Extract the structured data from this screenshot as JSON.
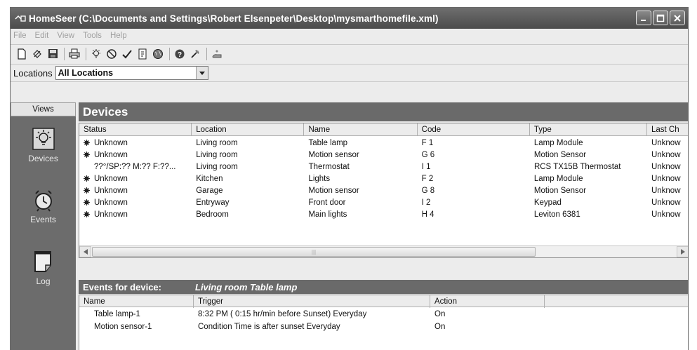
{
  "window": {
    "title": "HomeSeer (C:\\Documents and Settings\\Robert Elsenpeter\\Desktop\\mysmarthomefile.xml)",
    "buttons": [
      "minimize",
      "maximize",
      "close"
    ]
  },
  "menu": [
    "File",
    "Edit",
    "View",
    "Tools",
    "Help"
  ],
  "toolbar": {
    "icons": [
      "new-file-icon",
      "open-icon",
      "save-icon",
      "print-icon",
      "light-icon",
      "clock-icon",
      "check-icon",
      "document-icon",
      "globe-icon",
      "help-icon",
      "tool-icon",
      "hand-icon"
    ]
  },
  "locations": {
    "label": "Locations",
    "selected": "All Locations"
  },
  "views": {
    "header": "Views",
    "items": [
      {
        "label": "Devices",
        "icon": "lightbulb-icon"
      },
      {
        "label": "Events",
        "icon": "alarm-clock-icon"
      },
      {
        "label": "Log",
        "icon": "notepad-icon"
      }
    ]
  },
  "devices": {
    "title": "Devices",
    "columns": [
      "Status",
      "Location",
      "Name",
      "Code",
      "Type",
      "Last Ch"
    ],
    "rows": [
      {
        "status": "Unknown",
        "dot": true,
        "location": "Living room",
        "name": "Table lamp",
        "code": "F 1",
        "type": "Lamp Module",
        "last": "Unknow"
      },
      {
        "status": "Unknown",
        "dot": true,
        "location": "Living room",
        "name": "Motion sensor",
        "code": "G 6",
        "type": "Motion Sensor",
        "last": "Unknow"
      },
      {
        "status": "??°/SP:?? M:?? F:??...",
        "dot": false,
        "location": "Living room",
        "name": "Thermostat",
        "code": "I 1",
        "type": "RCS TX15B Thermostat",
        "last": "Unknow"
      },
      {
        "status": "Unknown",
        "dot": true,
        "location": "Kitchen",
        "name": "Lights",
        "code": "F 2",
        "type": "Lamp Module",
        "last": "Unknow"
      },
      {
        "status": "Unknown",
        "dot": true,
        "location": "Garage",
        "name": "Motion sensor",
        "code": "G 8",
        "type": "Motion Sensor",
        "last": "Unknow"
      },
      {
        "status": "Unknown",
        "dot": true,
        "location": "Entryway",
        "name": "Front door",
        "code": "I 2",
        "type": "Keypad",
        "last": "Unknow"
      },
      {
        "status": "Unknown",
        "dot": true,
        "location": "Bedroom",
        "name": "Main lights",
        "code": "H 4",
        "type": "Leviton 6381",
        "last": "Unknow"
      }
    ]
  },
  "events": {
    "header_label": "Events for device:",
    "device": "Living room Table lamp",
    "columns": [
      "Name",
      "Trigger",
      "Action",
      ""
    ],
    "rows": [
      {
        "name": "Table lamp-1",
        "trigger": "8:32 PM ( 0:15 hr/min before Sunset)  Everyday",
        "action": "On"
      },
      {
        "name": "Motion sensor-1",
        "trigger": "Condition Time is after sunset  Everyday",
        "action": "On"
      }
    ]
  }
}
